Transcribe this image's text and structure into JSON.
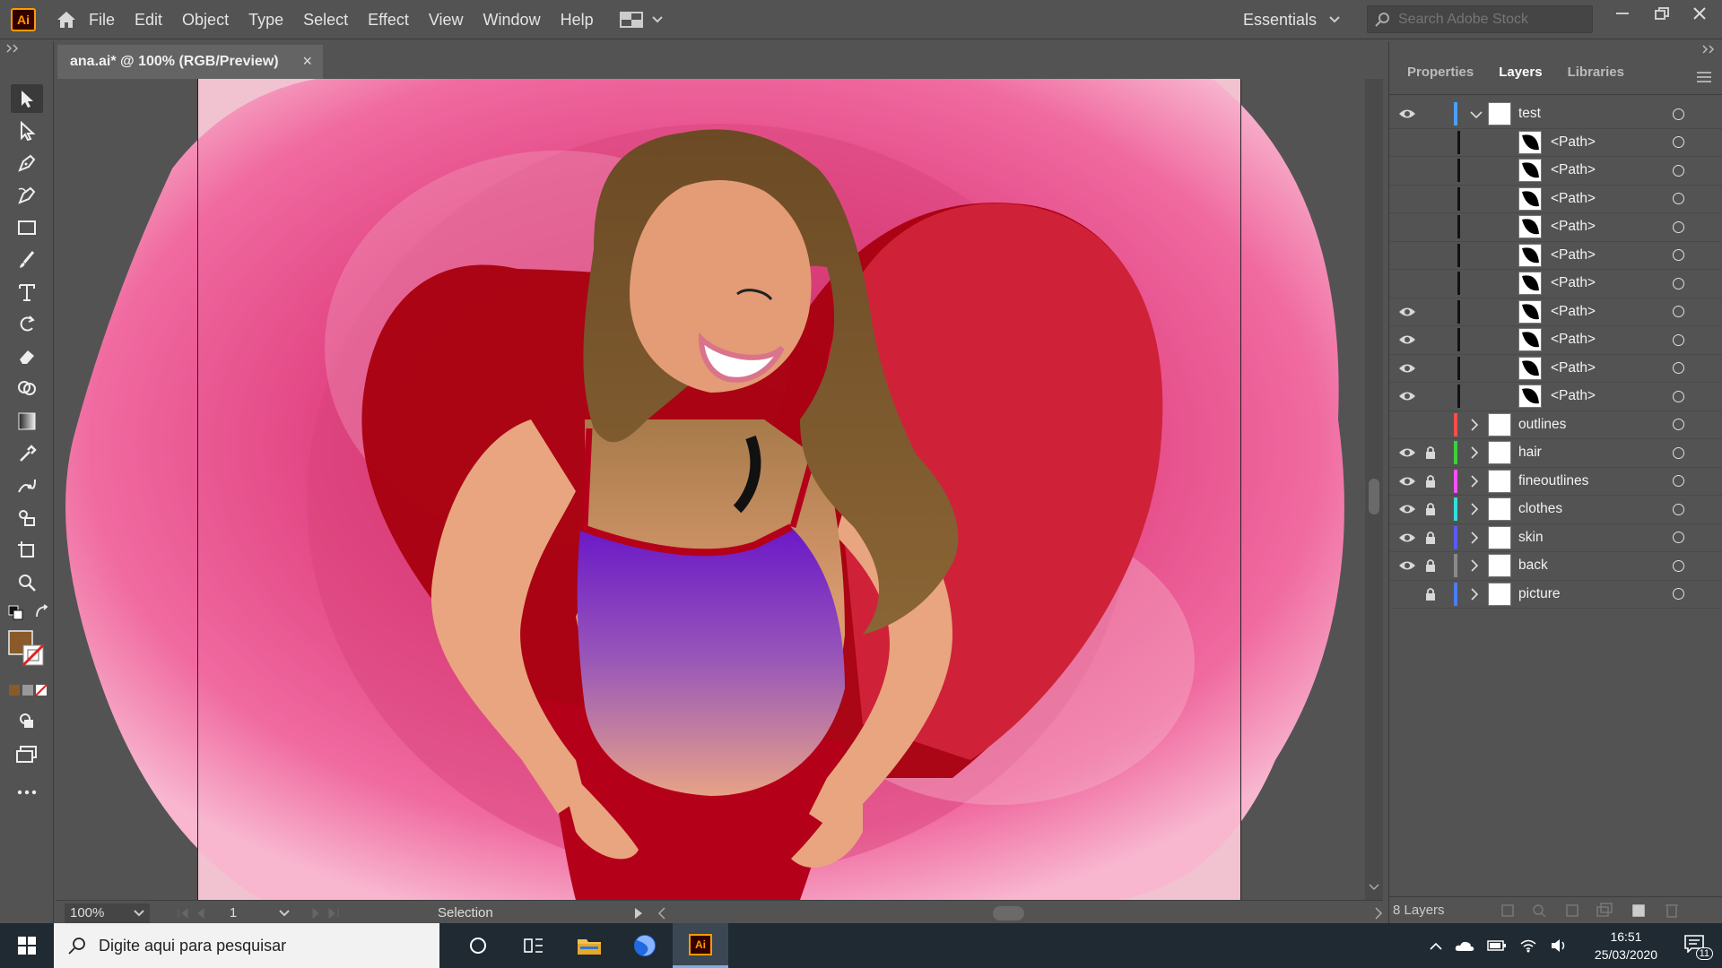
{
  "app": {
    "logo": "Ai",
    "accent": "#ff9a00"
  },
  "menu": [
    "File",
    "Edit",
    "Object",
    "Type",
    "Select",
    "Effect",
    "View",
    "Window",
    "Help"
  ],
  "workspace": "Essentials",
  "search": {
    "placeholder": "Search Adobe Stock"
  },
  "document": {
    "tab_title": "ana.ai* @ 100% (RGB/Preview)",
    "close": "×"
  },
  "status": {
    "zoom": "100%",
    "page": "1",
    "tool": "Selection"
  },
  "panel": {
    "tabs": [
      "Properties",
      "Layers",
      "Libraries"
    ],
    "active_tab": "Layers",
    "footer": "8 Layers",
    "layers": [
      {
        "name": "test",
        "expanded": true,
        "color": "#4aa0ff",
        "visible": true,
        "locked": false
      },
      {
        "name": "<Path>",
        "sub": true,
        "visible": false
      },
      {
        "name": "<Path>",
        "sub": true,
        "visible": false
      },
      {
        "name": "<Path>",
        "sub": true,
        "visible": false
      },
      {
        "name": "<Path>",
        "sub": true,
        "visible": false
      },
      {
        "name": "<Path>",
        "sub": true,
        "visible": false
      },
      {
        "name": "<Path>",
        "sub": true,
        "visible": false
      },
      {
        "name": "<Path>",
        "sub": true,
        "visible": true
      },
      {
        "name": "<Path>",
        "sub": true,
        "visible": true
      },
      {
        "name": "<Path>",
        "sub": true,
        "visible": true
      },
      {
        "name": "<Path>",
        "sub": true,
        "visible": true
      },
      {
        "name": "outlines",
        "color": "#ff4d4d",
        "visible": false,
        "locked": false
      },
      {
        "name": "hair",
        "color": "#3cd13c",
        "visible": true,
        "locked": true
      },
      {
        "name": "fineoutlines",
        "color": "#ff4dff",
        "visible": true,
        "locked": true
      },
      {
        "name": "clothes",
        "color": "#33dddd",
        "visible": true,
        "locked": true
      },
      {
        "name": "skin",
        "color": "#5a5aff",
        "visible": true,
        "locked": true
      },
      {
        "name": "back",
        "color": "#8a8a8a",
        "visible": true,
        "locked": true
      },
      {
        "name": "picture",
        "color": "#4a7dff",
        "visible": false,
        "locked": true
      }
    ]
  },
  "taskbar": {
    "search_placeholder": "Digite aqui para pesquisar",
    "time": "16:51",
    "date": "25/03/2020",
    "notifications": "11"
  }
}
